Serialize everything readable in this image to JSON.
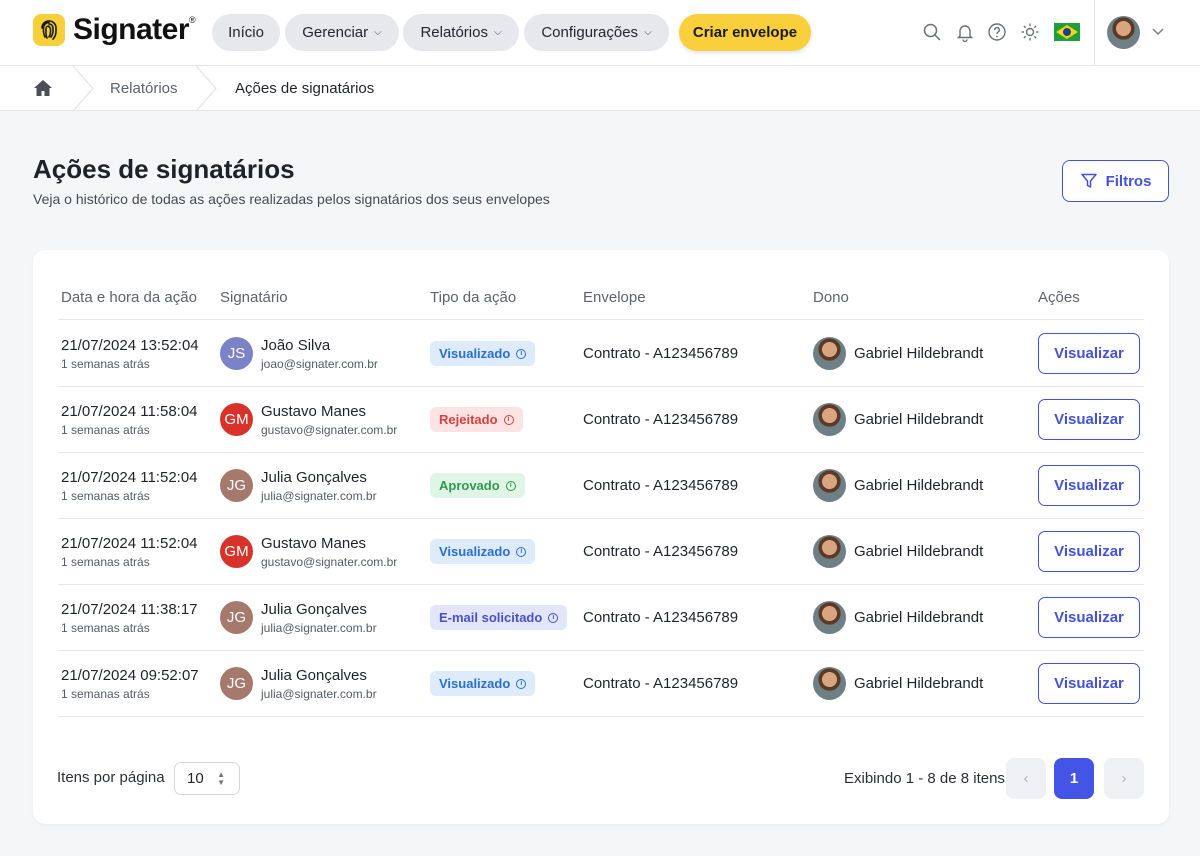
{
  "app": {
    "brand": "Signater",
    "brand_mark": "®"
  },
  "nav": {
    "inicio": "Início",
    "gerenciar": "Gerenciar",
    "relatorios": "Relatórios",
    "configuracoes": "Configurações",
    "criar": "Criar envelope",
    "chevron": "⌄"
  },
  "header_icons": [
    "search-icon",
    "bell-icon",
    "help-icon",
    "sun-icon",
    "brazil-flag-icon"
  ],
  "breadcrumb": {
    "items": [
      "Relatórios",
      "Ações de signatários"
    ]
  },
  "page": {
    "title": "Ações de signatários",
    "subtitle": "Veja o histórico de todas as ações realizadas pelos signatários dos seus envelopes",
    "filters_label": "Filtros"
  },
  "table": {
    "headers": [
      "Data e hora da ação",
      "Signatário",
      "Tipo da ação",
      "Envelope",
      "Dono",
      "Ações"
    ],
    "rows": [
      {
        "date": "21/07/2024 13:52:04",
        "ago": "1 semanas atrás",
        "initials": "JS",
        "name": "João Silva",
        "email": "joao@signater.com.br",
        "action": "Visualizado",
        "envelope": "Contrato - A123456789",
        "owner": "Gabriel Hildebrandt",
        "button": "Visualizar"
      },
      {
        "date": "21/07/2024 11:58:04",
        "ago": "1 semanas atrás",
        "initials": "GM",
        "name": "Gustavo Manes",
        "email": "gustavo@signater.com.br",
        "action": "Rejeitado",
        "envelope": "Contrato - A123456789",
        "owner": "Gabriel Hildebrandt",
        "button": "Visualizar"
      },
      {
        "date": "21/07/2024 11:52:04",
        "ago": "1 semanas atrás",
        "initials": "JG",
        "name": "Julia Gonçalves",
        "email": "julia@signater.com.br",
        "action": "Aprovado",
        "envelope": "Contrato - A123456789",
        "owner": "Gabriel Hildebrandt",
        "button": "Visualizar"
      },
      {
        "date": "21/07/2024 11:52:04",
        "ago": "1 semanas atrás",
        "initials": "GM",
        "name": "Gustavo Manes",
        "email": "gustavo@signater.com.br",
        "action": "Visualizado",
        "envelope": "Contrato - A123456789",
        "owner": "Gabriel Hildebrandt",
        "button": "Visualizar"
      },
      {
        "date": "21/07/2024 11:38:17",
        "ago": "1 semanas atrás",
        "initials": "JG",
        "name": "Julia Gonçalves",
        "email": "julia@signater.com.br",
        "action": "E-mail solicitado",
        "envelope": "Contrato - A123456789",
        "owner": "Gabriel Hildebrandt",
        "button": "Visualizar"
      },
      {
        "date": "21/07/2024 09:52:07",
        "ago": "1 semanas atrás",
        "initials": "JG",
        "name": "Julia Gonçalves",
        "email": "julia@signater.com.br",
        "action": "Visualizado",
        "envelope": "Contrato - A123456789",
        "owner": "Gabriel Hildebrandt",
        "button": "Visualizar"
      }
    ]
  },
  "colors": {
    "accent": "#4452d8",
    "brand_yellow": "#f9cf3b",
    "avatar_JS": "#7b82c7",
    "avatar_GM": "#d7332b",
    "avatar_JG": "#a57a6d",
    "badge_visualizado_bg": "#ddebfb",
    "badge_visualizado_fg": "#2a6fcf",
    "badge_rejeitado_bg": "#fde3e3",
    "badge_rejeitado_fg": "#d84040",
    "badge_aprovado_bg": "#e0f5e6",
    "badge_aprovado_fg": "#2f9a52",
    "badge_email_bg": "#e3e6fb",
    "badge_email_fg": "#4a4fc9"
  },
  "pagination": {
    "items_per_page_label": "Itens por página",
    "items_per_page": "10",
    "showing": "Exibindo 1 - 8 de 8 itens",
    "current_page": "1",
    "prev": "‹",
    "next": "›"
  }
}
